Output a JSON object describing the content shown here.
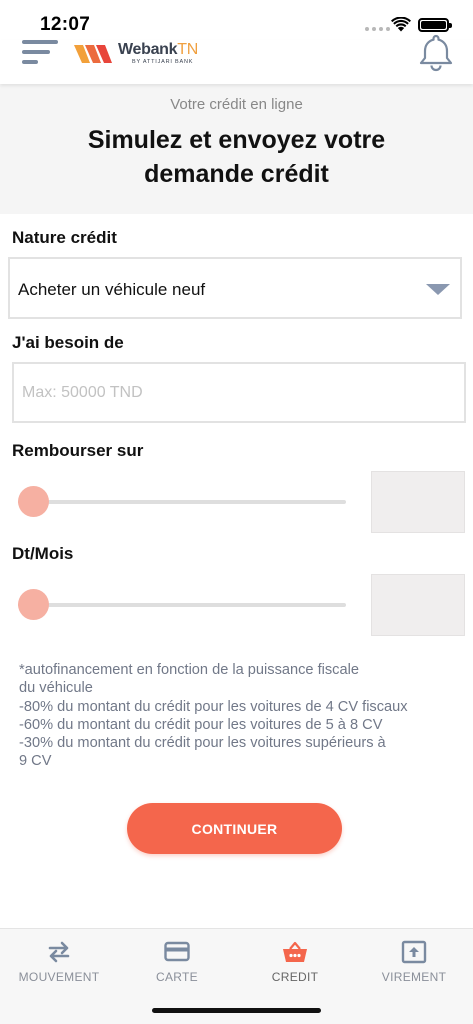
{
  "status": {
    "time": "12:07"
  },
  "header": {
    "logo_word": "Webank",
    "logo_accent": "TN",
    "logo_sub": "BY ATTIJARI BANK"
  },
  "hero": {
    "subtitle": "Votre crédit en ligne",
    "title_line1": "Simulez et envoyez votre",
    "title_line2": "demande crédit"
  },
  "form": {
    "nature_label": "Nature crédit",
    "nature_value": "Acheter un véhicule neuf",
    "besoin_label": "J'ai besoin de",
    "besoin_value": "",
    "besoin_placeholder": "Max: 50000 TND",
    "rembourser_label": "Rembourser sur",
    "rembourser_slider_level": 0,
    "rembourser_value": "",
    "mois_label": "Dt/Mois",
    "mois_slider_level": 0,
    "mois_value": ""
  },
  "notes": [
    "*autofinancement en fonction de la puissance fiscale",
    "du véhicule",
    "-80% du montant du crédit pour les voitures de 4 CV fiscaux",
    "-60% du montant du crédit pour les voitures de 5 à 8 CV",
    "-30% du montant du crédit pour les voitures supérieurs à",
    "9 CV"
  ],
  "actions": {
    "continue_label": "CONTINUER"
  },
  "tabs": [
    {
      "label": "MOUVEMENT",
      "icon": "transfer-arrows-icon"
    },
    {
      "label": "CARTE",
      "icon": "card-icon"
    },
    {
      "label": "CREDIT",
      "icon": "basket-icon",
      "active": true
    },
    {
      "label": "VIREMENT",
      "icon": "upload-box-icon"
    }
  ],
  "colors": {
    "accent": "#f4664c",
    "slider": "#f6b0a2",
    "icon_gray": "#7a8aa0",
    "credit_icon": "#f4664c"
  }
}
